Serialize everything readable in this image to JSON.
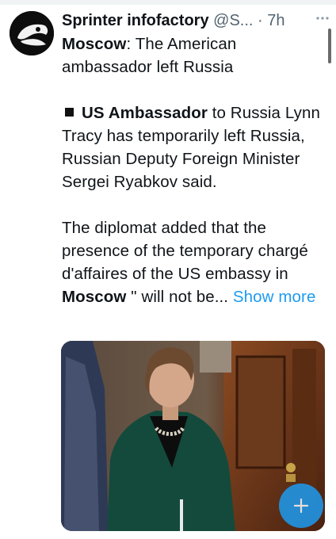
{
  "tweet": {
    "author_name": "Sprinter infofactory",
    "author_handle": "@S...",
    "separator": "·",
    "time": "7h",
    "line_1_bold": "Moscow",
    "line_1_rest": ": The American ambassador left Russia",
    "para_2_bold": "US Ambassador",
    "para_2_rest": " to Russia Lynn Tracy has temporarily left Russia, Russian Deputy Foreign Minister Sergei Ryabkov said.",
    "para_3_start": " The diplomat added that the presence of the temporary chargé d'affaires of the US embassy in ",
    "para_3_bold": "Moscow",
    "para_3_end": " \" will not be...",
    "show_more": " Show more"
  },
  "icons": {
    "more": "more-icon",
    "square": "black-square-icon",
    "compose": "plus-icon"
  },
  "colors": {
    "accent": "#1d9bf0",
    "secondary_text": "#536471"
  }
}
